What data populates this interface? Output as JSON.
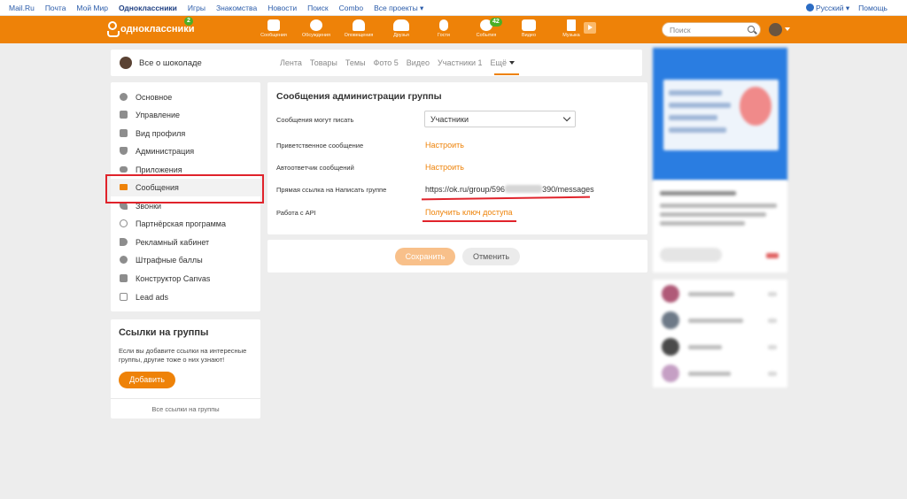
{
  "portal": {
    "links": [
      "Mail.Ru",
      "Почта",
      "Мой Мир",
      "Одноклассники",
      "Игры",
      "Знакомства",
      "Новости",
      "Поиск",
      "Combo",
      "Все проекты"
    ],
    "language": "Русский",
    "help": "Помощь"
  },
  "header": {
    "logo_text": "одноклассники",
    "logo_badge": "2",
    "nav": [
      {
        "label": "Сообщения",
        "icon": "envelope-icon",
        "badge": ""
      },
      {
        "label": "Обсуждения",
        "icon": "chat-icon",
        "badge": ""
      },
      {
        "label": "Оповещения",
        "icon": "bell-icon",
        "badge": ""
      },
      {
        "label": "Друзья",
        "icon": "friends-icon",
        "badge": ""
      },
      {
        "label": "Гости",
        "icon": "footprints-icon",
        "badge": ""
      },
      {
        "label": "События",
        "icon": "events-icon",
        "badge": "42"
      },
      {
        "label": "Видео",
        "icon": "video-camera-icon",
        "badge": ""
      },
      {
        "label": "Музыка",
        "icon": "music-note-icon",
        "badge": ""
      }
    ],
    "search_placeholder": "Поиск"
  },
  "group": {
    "name": "Все о шоколаде",
    "tabs": [
      "Лента",
      "Товары",
      "Темы",
      "Фото 5",
      "Видео",
      "Участники 1",
      "Ещё"
    ],
    "active_tab": "Ещё"
  },
  "sidebar": {
    "items": [
      {
        "label": "Основное",
        "icon": "gear-icon"
      },
      {
        "label": "Управление",
        "icon": "sliders-icon"
      },
      {
        "label": "Вид профиля",
        "icon": "layout-icon"
      },
      {
        "label": "Администрация",
        "icon": "shield-icon"
      },
      {
        "label": "Приложения",
        "icon": "gamepad-icon"
      },
      {
        "label": "Сообщения",
        "icon": "envelope-icon"
      },
      {
        "label": "Звонки",
        "icon": "phone-icon"
      },
      {
        "label": "Партнёрская программа",
        "icon": "at-sign-icon"
      },
      {
        "label": "Рекламный кабинет",
        "icon": "megaphone-icon"
      },
      {
        "label": "Штрафные баллы",
        "icon": "warning-icon"
      },
      {
        "label": "Конструктор Canvas",
        "icon": "canvas-icon"
      },
      {
        "label": "Lead ads",
        "icon": "checkbox-icon"
      }
    ],
    "active": "Сообщения"
  },
  "links_card": {
    "title": "Ссылки на группы",
    "description": "Если вы добавите ссылки на интересные группы, другие тоже о них узнают!",
    "add_button": "Добавить",
    "all_links": "Все ссылки на группы"
  },
  "settings": {
    "title": "Сообщения администрации группы",
    "rows": [
      {
        "label": "Сообщения могут писать",
        "value": "Участники"
      },
      {
        "label": "Приветственное сообщение",
        "value": "Настроить"
      },
      {
        "label": "Автоответчик сообщений",
        "value": "Настроить"
      },
      {
        "label": "Прямая ссылка на Написать группе",
        "value_start": "https://ok.ru/group/596",
        "value_end": "390/messages"
      },
      {
        "label": "Работа с API",
        "value": "Получить ключ доступа"
      }
    ],
    "save_button": "Сохранить",
    "cancel_button": "Отменить"
  },
  "colors": {
    "brand_orange": "#ee8208",
    "highlight_red": "#e0232b",
    "link_blue": "#2b5caa"
  }
}
